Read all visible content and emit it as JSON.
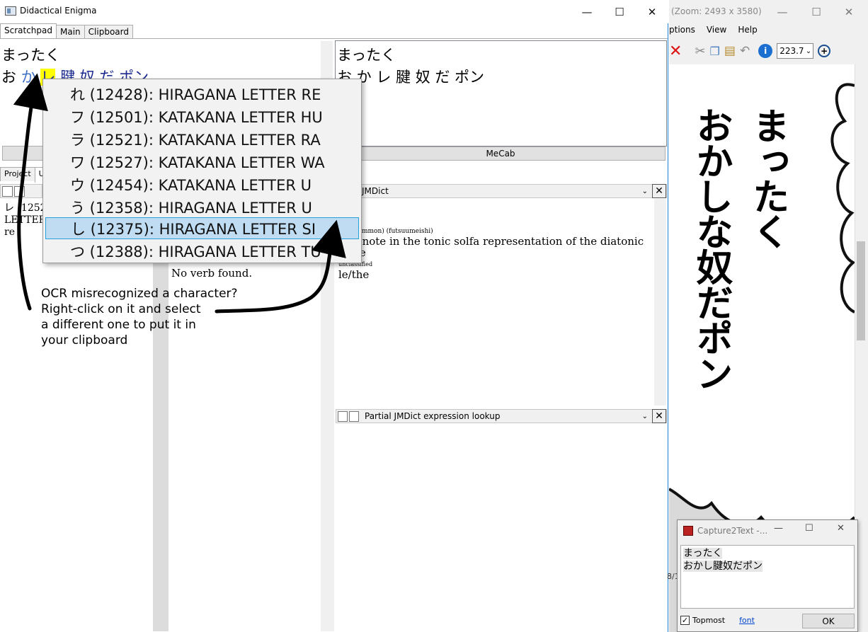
{
  "main_window": {
    "title": "Didactical Enigma",
    "caption_buttons": {
      "minimize": "—",
      "maximize": "☐",
      "close": "✕"
    },
    "tabs": [
      "Scratchpad",
      "Main",
      "Clipboard"
    ],
    "scratch_line1": "まったく",
    "scratch_line2_tokens": [
      "お",
      "か",
      "レ",
      "腱",
      "奴",
      "だ",
      "ポン"
    ],
    "mecab_input_line1": "まったく",
    "mecab_input_line2": "お か レ 腱 奴 だ ポン",
    "mecab_button": "MeCab",
    "lower_tabs": [
      "Project",
      "U"
    ],
    "left_panel_lines": [
      "レ (1252",
      "LETTER",
      "re"
    ],
    "verb_message": "No verb found.",
    "jmdict_panel": {
      "title": "JMDict",
      "pos_tag": "(common) (futsuumeishi)",
      "definition": "2nd note in the tonic solfa representation of the diatonic scale",
      "tag2": "unclassified",
      "reading": "le/the"
    },
    "partial_panel": {
      "title": "Partial JMDict expression lookup"
    },
    "dropdown_arrow": "⌄",
    "close_glyph": "✕"
  },
  "context_menu": {
    "items": [
      "れ (12428): HIRAGANA LETTER RE",
      "フ (12501): KATAKANA LETTER HU",
      "ラ (12521): KATAKANA LETTER RA",
      "ワ (12527): KATAKANA LETTER WA",
      "ウ (12454): KATAKANA LETTER U",
      "う (12358): HIRAGANA LETTER U",
      "し (12375): HIRAGANA LETTER SI",
      "つ (12388): HIRAGANA LETTER TU"
    ],
    "selected_index": 6
  },
  "annotation": {
    "lines": [
      "OCR misrecognized a character?",
      "Right-click on it and select",
      "a different one to put it in",
      "your clipboard"
    ]
  },
  "right_window": {
    "title": "(Zoom: 2493 x 3580)",
    "menu": [
      "ptions",
      "View",
      "Help"
    ],
    "zoom_value": "223.7",
    "manga_col1": "まったく",
    "manga_col2": "おかしな奴だポン",
    "status_fragment": "8/1"
  },
  "capture2text": {
    "title": "Capture2Text -...",
    "text_line1": "まったく",
    "text_line2": "おかし腱奴だポン",
    "topmost_label": "Topmost",
    "topmost_checked": true,
    "font_link": "font",
    "ok_button": "OK"
  },
  "colors": {
    "highlight": "#ffff00",
    "menu_selected": "#c0dcf3",
    "accent": "#1883d7"
  }
}
